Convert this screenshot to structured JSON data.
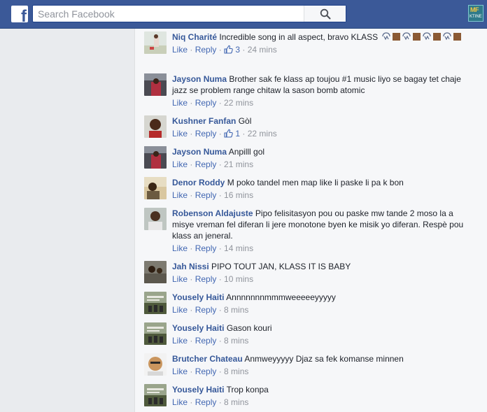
{
  "header": {
    "logo_letter": "f",
    "search_placeholder": "Search Facebook",
    "corner_app_top": "MF",
    "corner_app_bottom": "KTINE"
  },
  "comments": [
    {
      "name": "Niq Charité",
      "text": "Incredible song in all aspect, bravo KLASS",
      "emoji": [
        "gesture",
        "square",
        "gesture",
        "square",
        "gesture",
        "square",
        "gesture",
        "square"
      ],
      "like": "Like",
      "reply": "Reply",
      "reactions": "3",
      "time": "24 mins"
    },
    {
      "name": "Jayson Numa",
      "text": "Brother sak fe klass ap toujou #1 music liyo se bagay tet chaje jazz se problem range chitaw la sason bomb atomic",
      "like": "Like",
      "reply": "Reply",
      "time": "22 mins"
    },
    {
      "name": "Kushner Fanfan",
      "text": "Gòl",
      "like": "Like",
      "reply": "Reply",
      "reactions": "1",
      "time": "22 mins"
    },
    {
      "name": "Jayson Numa",
      "text": "Anpilll gol",
      "like": "Like",
      "reply": "Reply",
      "time": "21 mins"
    },
    {
      "name": "Denor Roddy",
      "text": "M poko tandel men map like li paske li pa k bon",
      "like": "Like",
      "reply": "Reply",
      "time": "16 mins"
    },
    {
      "name": "Robenson Aldajuste",
      "text": "Pipo felisitasyon pou ou paske mw tande 2 moso la a misye vreman fel diferan li jere monotone byen ke misik yo diferan. Respè pou klass an jeneral.",
      "like": "Like",
      "reply": "Reply",
      "time": "14 mins"
    },
    {
      "name": "Jah Nissi",
      "text": "PIPO TOUT JAN, KLASS IT IS BABY",
      "like": "Like",
      "reply": "Reply",
      "time": "10 mins"
    },
    {
      "name": "Yousely Haiti",
      "text": "Annnnnnnmmmweeeeeyyyyy",
      "like": "Like",
      "reply": "Reply",
      "time": "8 mins"
    },
    {
      "name": "Yousely Haiti",
      "text": "Gason kouri",
      "like": "Like",
      "reply": "Reply",
      "time": "8 mins"
    },
    {
      "name": "Brutcher Chateau",
      "text": "Anmweyyyyy Djaz sa fek komanse minnen",
      "like": "Like",
      "reply": "Reply",
      "time": "8 mins"
    },
    {
      "name": "Yousely Haiti",
      "text": "Trop konpa",
      "like": "Like",
      "reply": "Reply",
      "time": "8 mins"
    }
  ],
  "colors": {
    "topbar": "#3b5998",
    "name": "#365899",
    "link": "#4267b2",
    "meta": "#90949c",
    "panel": "#f6f7f9",
    "page": "#e9ebee"
  }
}
